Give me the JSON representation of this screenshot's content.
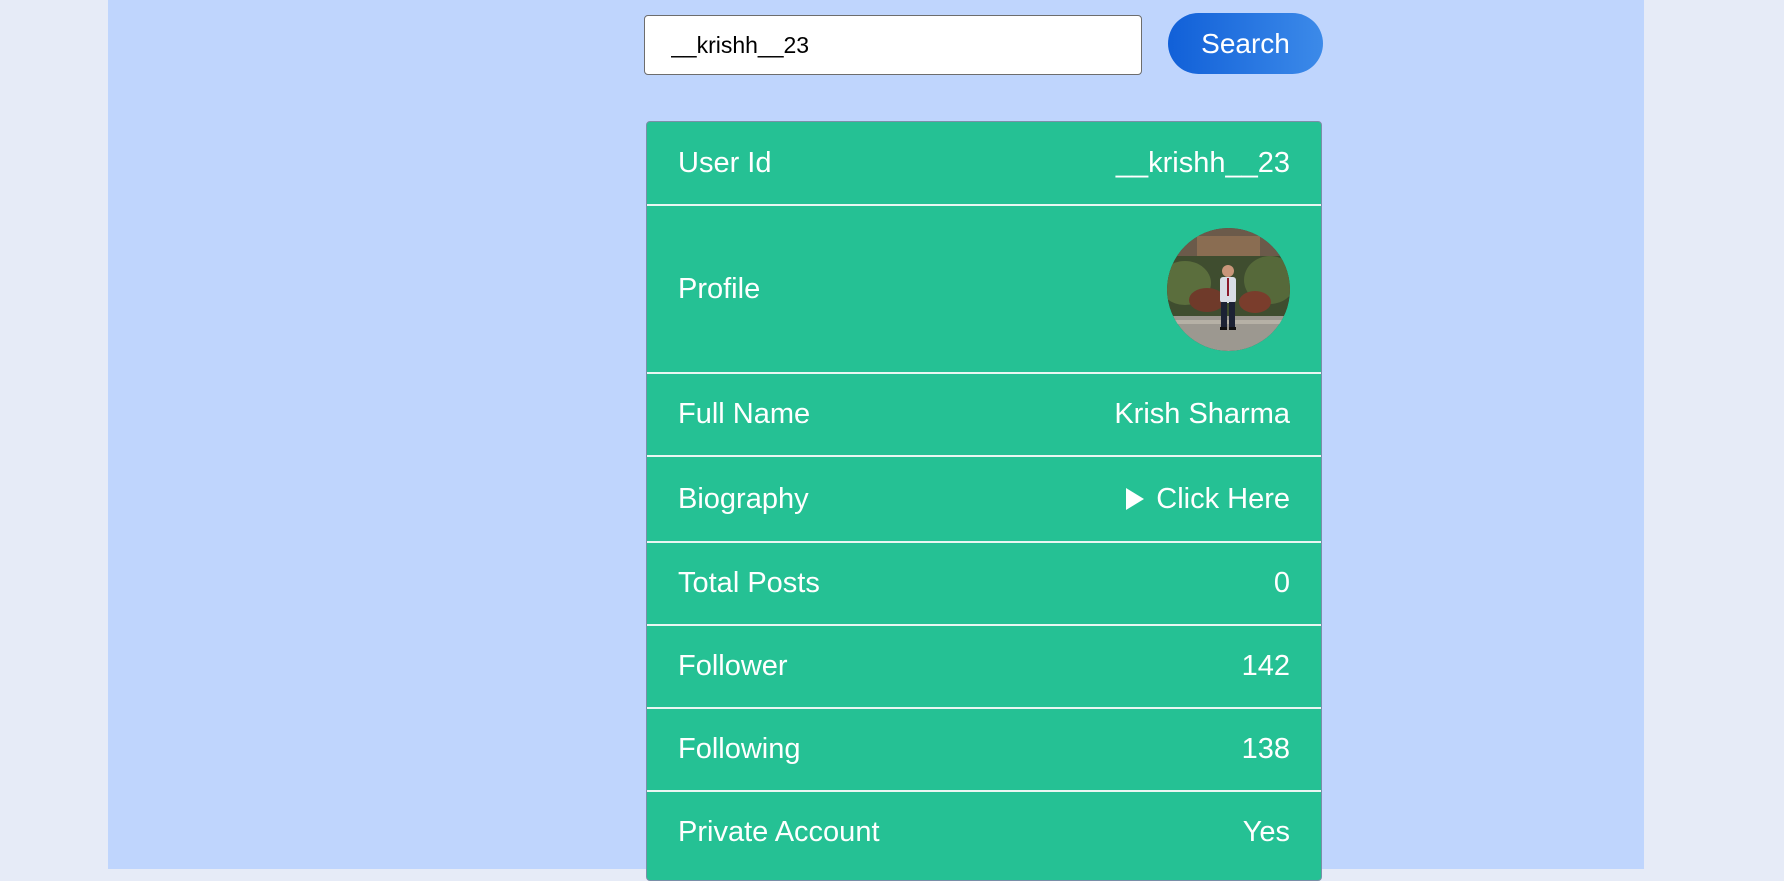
{
  "search": {
    "value": "__krishh__23",
    "button_label": "Search"
  },
  "profile_card": {
    "rows": {
      "user_id": {
        "label": "User Id",
        "value": "__krishh__23"
      },
      "profile": {
        "label": "Profile",
        "image": "profile-photo"
      },
      "full_name": {
        "label": "Full Name",
        "value": "Krish Sharma"
      },
      "biography": {
        "label": "Biography",
        "value": "Click Here",
        "icon": "disclosure-triangle-icon"
      },
      "total_posts": {
        "label": "Total Posts",
        "value": "0"
      },
      "follower": {
        "label": "Follower",
        "value": "142"
      },
      "following": {
        "label": "Following",
        "value": "138"
      },
      "private_account": {
        "label": "Private Account",
        "value": "Yes"
      }
    }
  },
  "colors": {
    "page_background": "#bfd5fd",
    "outer_background": "#e6ebf7",
    "card_background": "#25c194",
    "button_gradient_start": "#1160d8",
    "button_gradient_end": "#3c8ae9"
  }
}
